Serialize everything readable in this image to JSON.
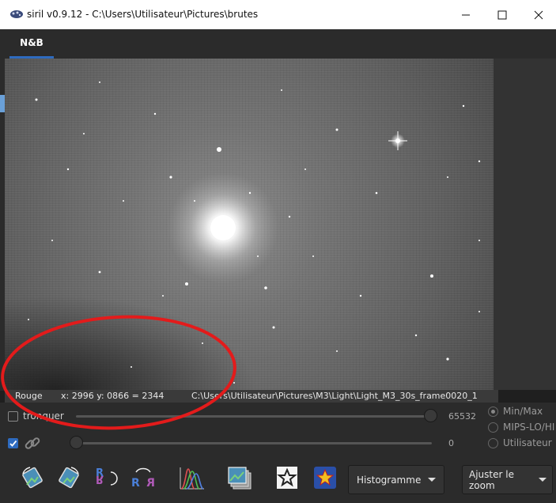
{
  "window": {
    "title": "siril v0.9.12 - C:\\Users\\Utilisateur\\Pictures\\brutes"
  },
  "tabs": [
    {
      "label": "N&B",
      "active": true
    }
  ],
  "status": {
    "channel": "Rouge",
    "coords": "x: 2996 y: 0866 = 2344",
    "filepath": "C:\\Users\\Utilisateur\\Pictures\\M3\\Light\\Light_M3_30s_frame0020_1"
  },
  "controls": {
    "clip_label": "tronquer",
    "clip_checked": false,
    "link_checked": true,
    "high_value": "65532",
    "low_value": "0"
  },
  "scale_modes": [
    {
      "label": "Min/Max",
      "selected": true
    },
    {
      "label": "MIPS-LO/HI",
      "selected": false
    },
    {
      "label": "Utilisateur",
      "selected": false
    }
  ],
  "toolbar": {
    "display_mode": "Histogramme",
    "zoom": "Ajuster le zoom"
  },
  "colors": {
    "accent": "#2e6bbf",
    "annotation": "#e31b1b"
  }
}
